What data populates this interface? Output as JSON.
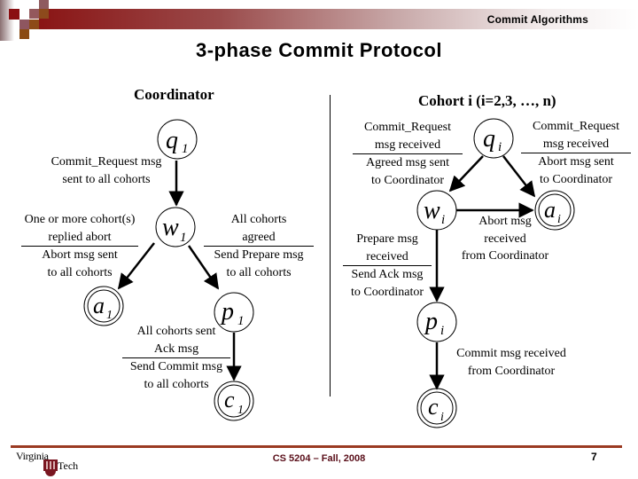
{
  "header": {
    "section_label": "Commit Algorithms",
    "title": "3-phase Commit Protocol",
    "colors": {
      "accent_bar": "#8a1515",
      "footer_rule": "#9a3a22",
      "footer_text": "#5a0f1a"
    }
  },
  "coordinator": {
    "heading": "Coordinator",
    "states": {
      "q": {
        "name": "q",
        "sub": "1",
        "final": false
      },
      "w": {
        "name": "w",
        "sub": "1",
        "final": false
      },
      "a": {
        "name": "a",
        "sub": "1",
        "final": true
      },
      "p": {
        "name": "p",
        "sub": "1",
        "final": false
      },
      "c": {
        "name": "c",
        "sub": "1",
        "final": true
      }
    },
    "transitions": {
      "q_to_w": {
        "lines": [
          "Commit_Request msg",
          "sent to all cohorts"
        ]
      },
      "w_to_a": {
        "condition": [
          "One or more cohort(s)",
          "replied abort"
        ],
        "action": [
          "Abort msg sent",
          "to all cohorts"
        ]
      },
      "w_to_p": {
        "condition": [
          "All cohorts",
          "agreed"
        ],
        "action": [
          "Send Prepare msg",
          "to all cohorts"
        ]
      },
      "p_to_c": {
        "condition": [
          "All cohorts sent",
          "Ack msg"
        ],
        "action": [
          "Send Commit msg",
          "to all cohorts"
        ]
      }
    }
  },
  "cohort": {
    "heading": "Cohort i (i=2,3, …, n)",
    "states": {
      "q": {
        "name": "q",
        "sub": "i",
        "final": false
      },
      "w": {
        "name": "w",
        "sub": "i",
        "final": false
      },
      "a": {
        "name": "a",
        "sub": "i",
        "final": true
      },
      "p": {
        "name": "p",
        "sub": "i",
        "final": false
      },
      "c": {
        "name": "c",
        "sub": "i",
        "final": true
      }
    },
    "transitions": {
      "q_to_w": {
        "condition": [
          "Commit_Request",
          "msg received"
        ],
        "action": [
          "Agreed msg sent",
          "to Coordinator"
        ]
      },
      "q_to_a": {
        "condition": [
          "Commit_Request",
          "msg received"
        ],
        "action": [
          "Abort msg sent",
          "to Coordinator"
        ]
      },
      "w_to_a": {
        "lines": [
          "Abort msg",
          "received",
          "from Coordinator"
        ]
      },
      "w_to_p": {
        "condition": [
          "Prepare msg",
          "received"
        ],
        "action": [
          "Send Ack msg",
          "to Coordinator"
        ]
      },
      "p_to_c": {
        "lines": [
          "Commit msg received",
          "from Coordinator"
        ]
      }
    }
  },
  "footer": {
    "logo_top": "Virginia",
    "logo_bottom": "Tech",
    "course": "CS 5204 – Fall, 2008",
    "page_number": "7"
  }
}
